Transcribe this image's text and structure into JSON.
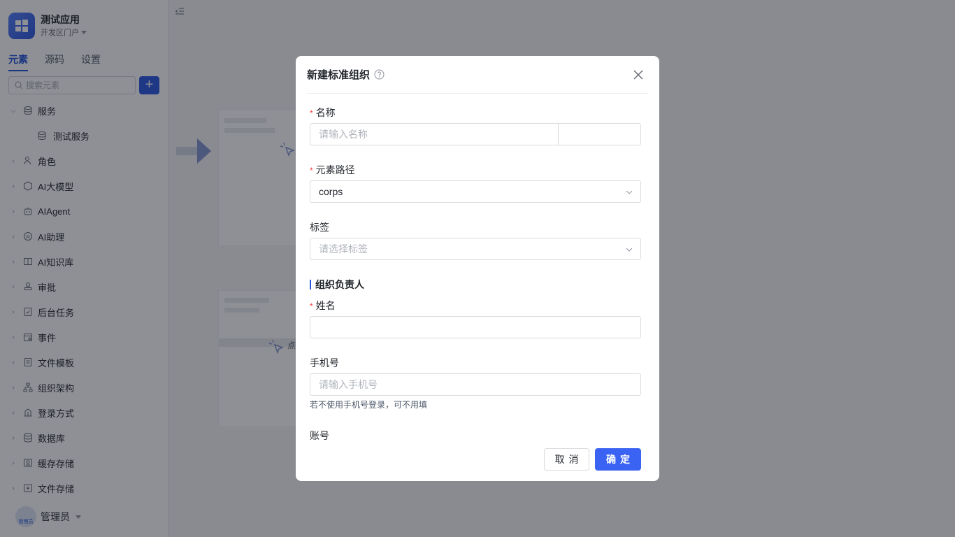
{
  "app": {
    "name": "测试应用",
    "env": "开发区门户"
  },
  "sidebar": {
    "tabs": [
      {
        "label": "元素"
      },
      {
        "label": "源码"
      },
      {
        "label": "设置"
      }
    ],
    "search_placeholder": "搜索元素",
    "add_label": "+",
    "tree": [
      {
        "label": "服务",
        "icon": "database-icon",
        "expanded": true
      },
      {
        "label": "测试服务",
        "icon": "database-icon",
        "child": true
      },
      {
        "label": "角色",
        "icon": "user-group-icon"
      },
      {
        "label": "AI大模型",
        "icon": "hexagon-icon"
      },
      {
        "label": "AIAgent",
        "icon": "robot-icon"
      },
      {
        "label": "AI助理",
        "icon": "ai-assistant-icon"
      },
      {
        "label": "AI知识库",
        "icon": "book-icon"
      },
      {
        "label": "审批",
        "icon": "stamp-icon"
      },
      {
        "label": "后台任务",
        "icon": "task-icon"
      },
      {
        "label": "事件",
        "icon": "event-icon"
      },
      {
        "label": "文件模板",
        "icon": "file-template-icon"
      },
      {
        "label": "组织架构",
        "icon": "org-icon"
      },
      {
        "label": "登录方式",
        "icon": "login-icon"
      },
      {
        "label": "数据库",
        "icon": "db-icon"
      },
      {
        "label": "缓存存储",
        "icon": "cache-icon"
      },
      {
        "label": "文件存储",
        "icon": "file-storage-icon"
      }
    ]
  },
  "user": {
    "name": "管理员",
    "avatar_text": "管理员"
  },
  "background": {
    "hint_text": "点"
  },
  "modal": {
    "title": "新建标准组织",
    "fields": {
      "name": {
        "label": "名称",
        "placeholder": "请输入名称",
        "value": ""
      },
      "path": {
        "label": "元素路径",
        "value": "corps"
      },
      "tags": {
        "label": "标签",
        "placeholder": "请选择标签"
      },
      "section": "组织负责人",
      "person_name": {
        "label": "姓名",
        "value": ""
      },
      "phone": {
        "label": "手机号",
        "placeholder": "请输入手机号",
        "hint": "若不使用手机号登录，可不用填"
      },
      "account": {
        "label": "账号"
      }
    },
    "cancel_label": "取消",
    "ok_label": "确定"
  }
}
